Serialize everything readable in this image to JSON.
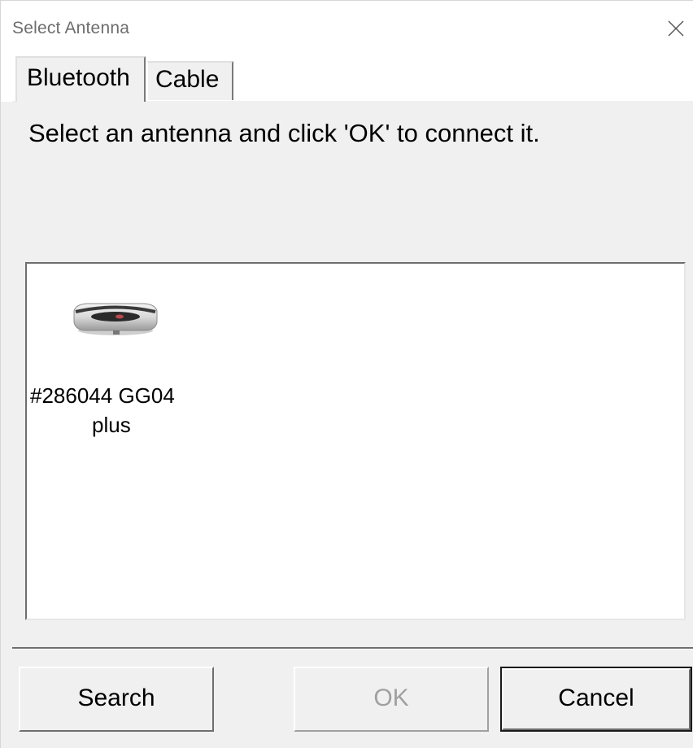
{
  "window": {
    "title": "Select Antenna",
    "close_icon": "close-icon"
  },
  "tabs": [
    {
      "label": "Bluetooth",
      "selected": true
    },
    {
      "label": "Cable",
      "selected": false
    }
  ],
  "panel": {
    "instruction": "Select an antenna and click 'OK' to connect it.",
    "devices": [
      {
        "name_line1": "#286044 GG04",
        "name_line2": "plus",
        "icon": "gnss-antenna-icon"
      }
    ]
  },
  "buttons": {
    "search": "Search",
    "ok": "OK",
    "ok_enabled": false,
    "cancel": "Cancel"
  }
}
